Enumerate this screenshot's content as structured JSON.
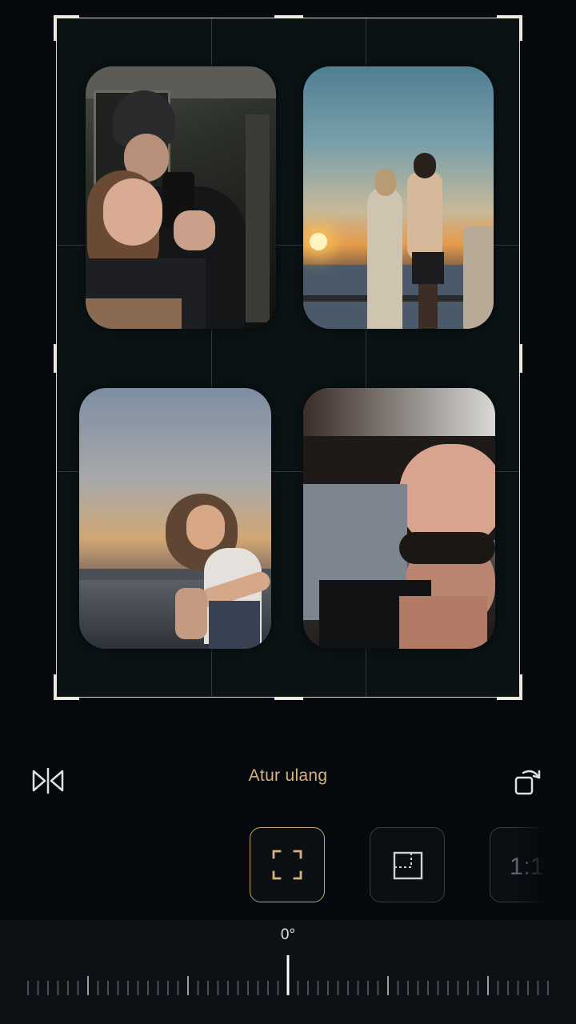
{
  "toolbar": {
    "reset_label": "Atur ulang",
    "flip_icon": "flip-horizontal-icon",
    "rotate_icon": "rotate-icon"
  },
  "aspect_ratios": {
    "items": [
      {
        "id": "free",
        "icon": "crop-free-icon",
        "active": true
      },
      {
        "id": "rect",
        "icon": "crop-rect-icon",
        "active": false
      },
      {
        "id": "1:1",
        "label": "1:1",
        "active": false
      }
    ]
  },
  "rotation": {
    "angle_label": "0°",
    "value": 0
  },
  "colors": {
    "accent": "#c9a46c",
    "reset_text": "#d8b27a",
    "background": "#05080d"
  }
}
